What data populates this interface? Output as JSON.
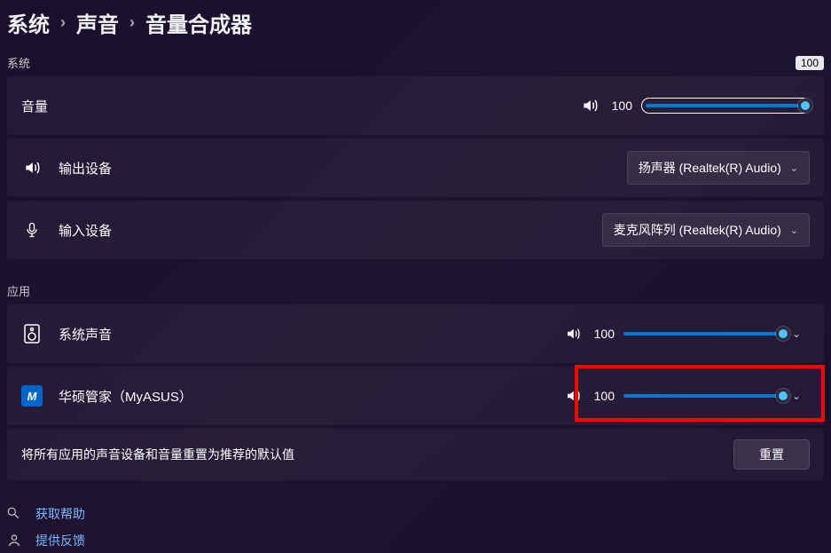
{
  "breadcrumb": {
    "system": "系统",
    "sound": "声音",
    "mixer": "音量合成器"
  },
  "system_section": {
    "label": "系统",
    "badge": "100",
    "volume": {
      "label": "音量",
      "value": "100",
      "percent": 100
    },
    "output": {
      "label": "输出设备",
      "selected": "扬声器 (Realtek(R) Audio)"
    },
    "input": {
      "label": "输入设备",
      "selected": "麦克风阵列 (Realtek(R) Audio)"
    }
  },
  "apps_section": {
    "label": "应用",
    "items": [
      {
        "name": "系统声音",
        "value": "100",
        "percent": 100,
        "icon": "speaker-box"
      },
      {
        "name": "华硕管家（MyASUS）",
        "value": "100",
        "percent": 100,
        "icon": "myasus"
      }
    ]
  },
  "reset": {
    "text": "将所有应用的声音设备和音量重置为推荐的默认值",
    "button": "重置"
  },
  "footer": {
    "help": "获取帮助",
    "feedback": "提供反馈"
  }
}
